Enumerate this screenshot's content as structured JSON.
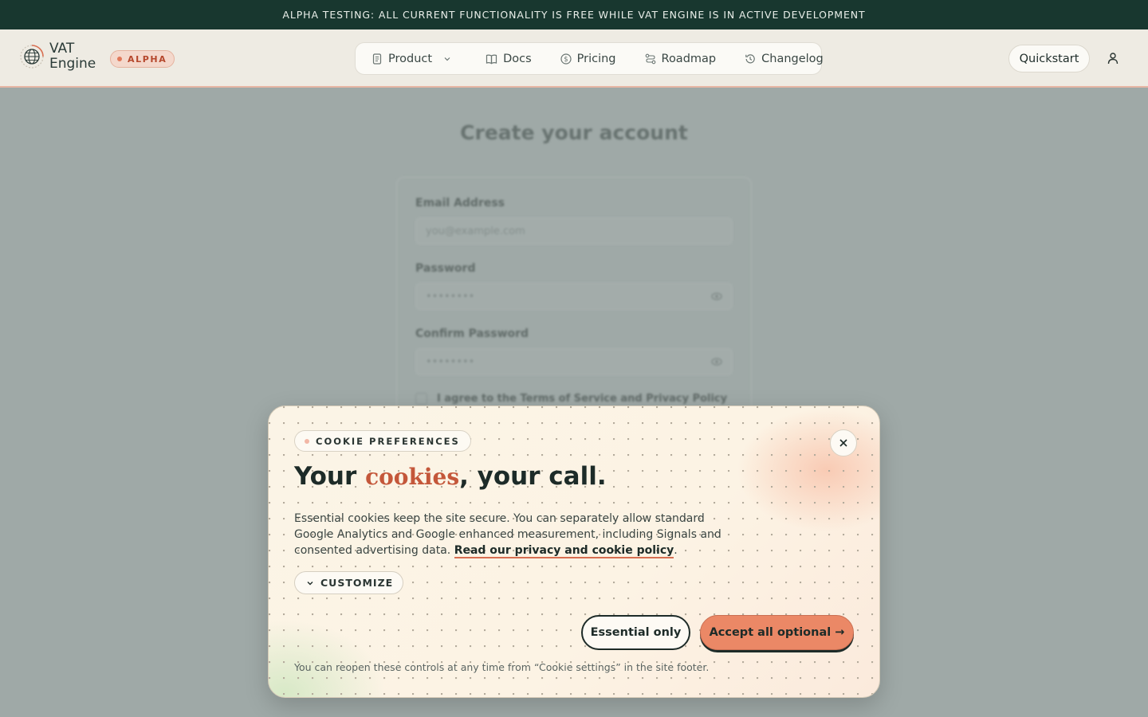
{
  "announcement": {
    "text": "ALPHA TESTING: ALL CURRENT FUNCTIONALITY IS FREE WHILE VAT ENGINE IS IN ACTIVE DEVELOPMENT"
  },
  "header": {
    "logo_line1": "VAT",
    "logo_line2": "Engine",
    "badge": "ALPHA",
    "nav": [
      {
        "label": "Product",
        "icon": "document-icon",
        "has_dropdown": true
      },
      {
        "label": "Docs",
        "icon": "book-icon"
      },
      {
        "label": "Pricing",
        "icon": "dollar-icon"
      },
      {
        "label": "Roadmap",
        "icon": "route-icon"
      },
      {
        "label": "Changelog",
        "icon": "history-icon"
      }
    ],
    "quickstart_label": "Quickstart",
    "user_icon": "user-icon"
  },
  "signup": {
    "title": "Create your account",
    "email_label": "Email Address",
    "email_placeholder": "you@example.com",
    "password_label": "Password",
    "password_placeholder": "••••••••",
    "confirm_label": "Confirm Password",
    "confirm_placeholder": "••••••••",
    "terms_label": "I agree to the Terms of Service and Privacy Policy"
  },
  "cookie_modal": {
    "pill_label": "COOKIE PREFERENCES",
    "headline_before": "Your ",
    "headline_accent": "cookies",
    "headline_after": ", your call.",
    "body": "Essential cookies keep the site secure. You can separately allow standard Google Analytics and Google enhanced measurement, including Signals and consented advertising data. ",
    "policy_link": "Read our privacy and cookie policy",
    "body_end": ".",
    "customize_label": "CUSTOMIZE",
    "essential_label": "Essential only",
    "accept_label": "Accept all optional →",
    "footnote": "You can reopen these controls at any time from “Cookie settings” in the site footer."
  },
  "colors": {
    "announcement_bg": "#18372f",
    "accent": "#eb8866",
    "accent_text": "#c4573a",
    "dark": "#1d2b28"
  }
}
